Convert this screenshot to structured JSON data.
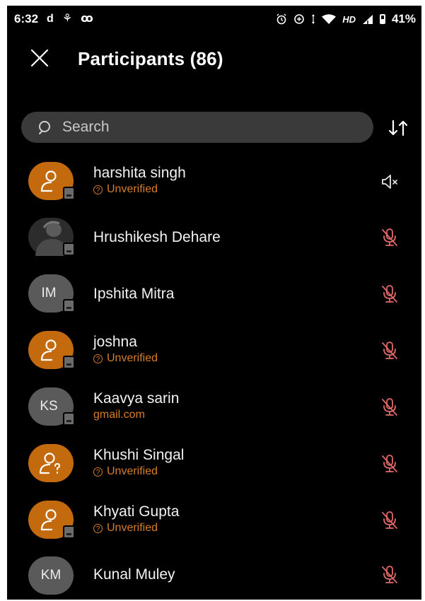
{
  "status_bar": {
    "time": "6:32",
    "left_icons": [
      "d",
      "⚘",
      "ꝏ"
    ],
    "network_label": "HD",
    "battery": "41%"
  },
  "header": {
    "title": "Participants (86)"
  },
  "search": {
    "placeholder": "Search"
  },
  "participants": [
    {
      "name": "harshita singh",
      "subtitle": "Unverified",
      "avatar_type": "guest",
      "speaker_muted": true
    },
    {
      "name": "Hrushikesh Dehare",
      "subtitle": "",
      "avatar_type": "photo",
      "mic_muted": true
    },
    {
      "name": "Ipshita Mitra",
      "subtitle": "",
      "avatar_type": "initials",
      "initials": "IM",
      "mic_muted": true
    },
    {
      "name": "joshna",
      "subtitle": "Unverified",
      "avatar_type": "guest",
      "mic_muted": true
    },
    {
      "name": "Kaavya sarin",
      "subtitle": "gmail.com",
      "avatar_type": "initials",
      "initials": "KS",
      "mic_muted": true
    },
    {
      "name": "Khushi Singal",
      "subtitle": "Unverified",
      "avatar_type": "guest",
      "mic_muted": true
    },
    {
      "name": "Khyati Gupta",
      "subtitle": "Unverified",
      "avatar_type": "guest",
      "mic_muted": true
    },
    {
      "name": "Kunal Muley",
      "subtitle": "",
      "avatar_type": "initials",
      "initials": "KM",
      "mic_muted": true
    }
  ],
  "colors": {
    "background": "#000000",
    "guest_avatar": "#c46a0e",
    "unverified_text": "#d57d2a",
    "muted_mic": "#e06a6a",
    "search_bg": "#3a3a3a"
  }
}
